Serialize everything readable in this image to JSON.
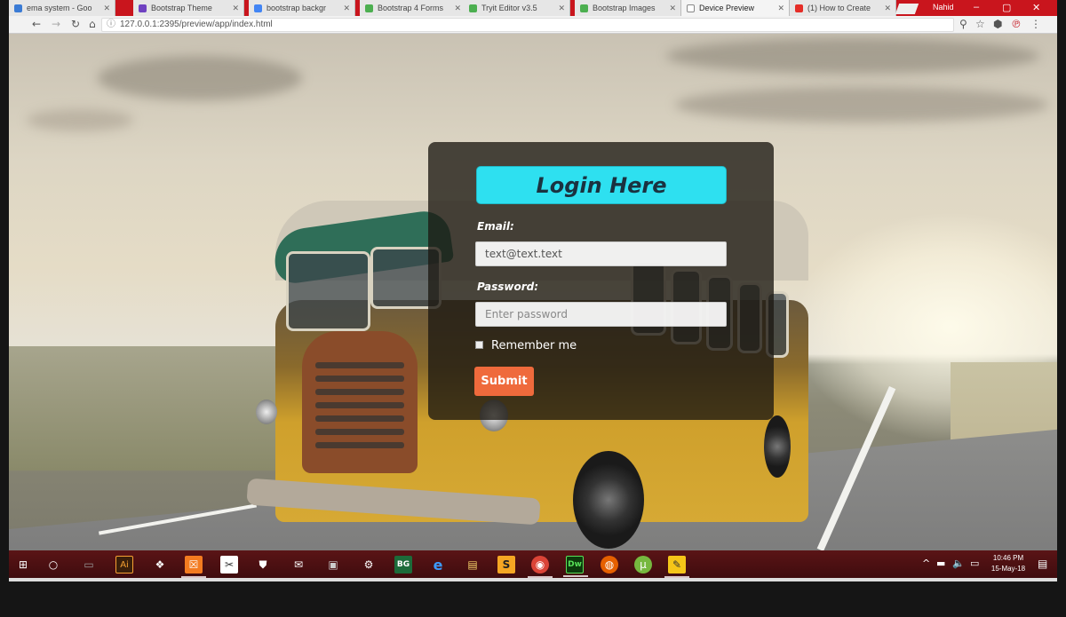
{
  "browser": {
    "tabs": [
      {
        "label": "ema system - Goo",
        "color": "#3a7bd5"
      },
      {
        "label": "Bootstrap Theme",
        "color": "#6f42c1"
      },
      {
        "label": "bootstrap backgr",
        "color": "#4285f4"
      },
      {
        "label": "Bootstrap 4 Forms",
        "color": "#4caf50"
      },
      {
        "label": "Tryit Editor v3.5",
        "color": "#4caf50"
      },
      {
        "label": "Bootstrap Images",
        "color": "#4caf50"
      },
      {
        "label": "Device Preview",
        "color": "#888888"
      },
      {
        "label": "(1) How to Create",
        "color": "#e52d27"
      }
    ],
    "active_tab_index": 6,
    "profile_name": "Nahid",
    "address": "127.0.0.1:2395/preview/app/index.html",
    "window_controls": {
      "minimize": "‒",
      "maximize": "▢",
      "close": "✕"
    }
  },
  "login": {
    "title": "Login Here",
    "email_label": "Email:",
    "email_value": "text@text.text",
    "password_label": "Password:",
    "password_placeholder": "Enter password",
    "remember_label": "Remember me",
    "submit_label": "Submit"
  },
  "taskbar": {
    "icons": [
      {
        "name": "windows-start-icon",
        "glyph": "⊞",
        "bg": "transparent"
      },
      {
        "name": "cortana-search-icon",
        "glyph": "○",
        "bg": "transparent"
      },
      {
        "name": "task-view-icon",
        "glyph": "▭",
        "bg": "transparent"
      },
      {
        "name": "illustrator-icon",
        "glyph": "Ai",
        "bg": "#3a1f0a"
      },
      {
        "name": "network-app-icon",
        "glyph": "❖",
        "bg": "transparent"
      },
      {
        "name": "xampp-icon",
        "glyph": "☒",
        "bg": "#f37b20"
      },
      {
        "name": "snipping-tool-icon",
        "glyph": "✂",
        "bg": "#ffffff"
      },
      {
        "name": "store-icon",
        "glyph": "⛊",
        "bg": "transparent"
      },
      {
        "name": "mail-icon",
        "glyph": "✉",
        "bg": "transparent"
      },
      {
        "name": "terminal-icon",
        "glyph": "▣",
        "bg": "transparent"
      },
      {
        "name": "settings-icon",
        "glyph": "⚙",
        "bg": "transparent"
      },
      {
        "name": "bg-app-icon",
        "glyph": "BG",
        "bg": "#1c6b3a"
      },
      {
        "name": "edge-icon",
        "glyph": "e",
        "bg": "transparent"
      },
      {
        "name": "file-explorer-icon",
        "glyph": "▤",
        "bg": "transparent"
      },
      {
        "name": "sublime-text-icon",
        "glyph": "S",
        "bg": "#f5a623"
      },
      {
        "name": "chrome-icon",
        "glyph": "◉",
        "bg": "#db4437"
      },
      {
        "name": "dreamweaver-icon",
        "glyph": "Dw",
        "bg": "#0c3b0c"
      },
      {
        "name": "firefox-icon",
        "glyph": "◍",
        "bg": "#e66000"
      },
      {
        "name": "utorrent-icon",
        "glyph": "μ",
        "bg": "#76b83f"
      },
      {
        "name": "notes-app-icon",
        "glyph": "✎",
        "bg": "#f5c518"
      }
    ],
    "time": "10:46 PM",
    "date": "15-May-18",
    "tray": {
      "up_arrow": "^",
      "network": "▬",
      "volume": "🔈",
      "message": "▭",
      "notifications": "▤"
    }
  }
}
